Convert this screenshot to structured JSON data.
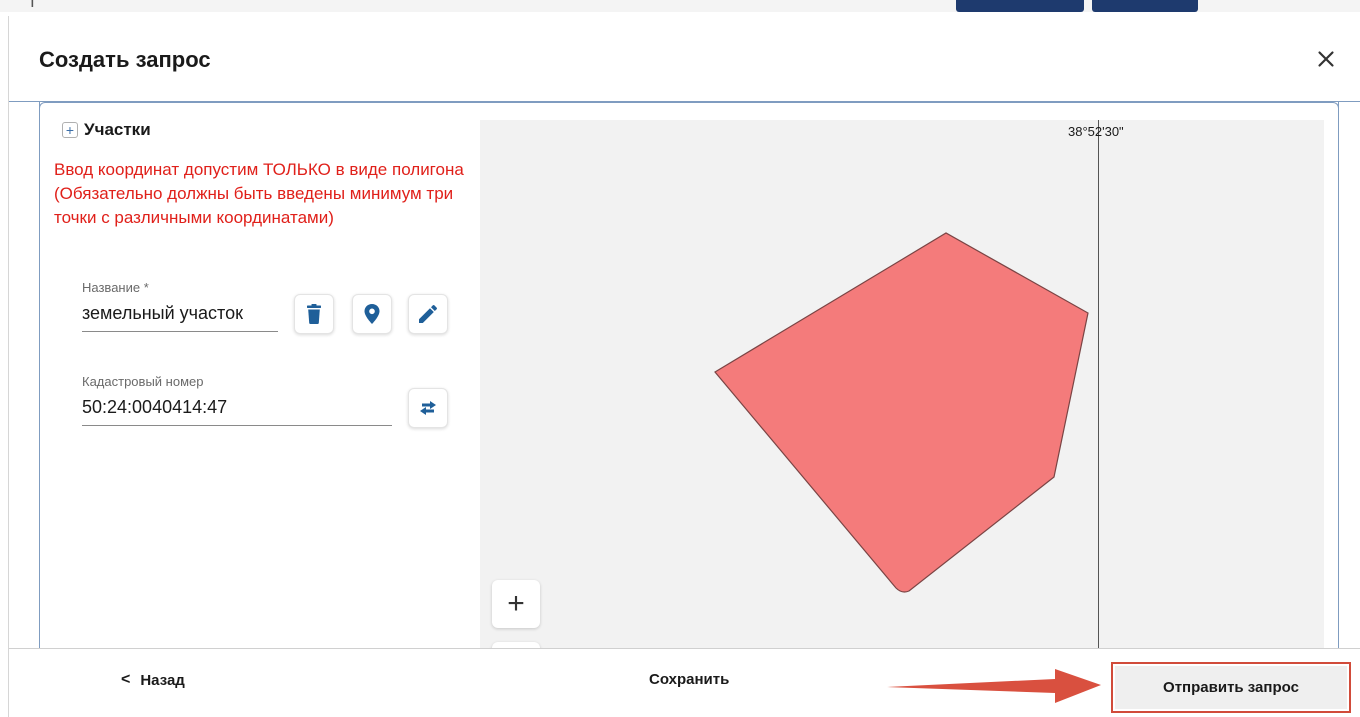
{
  "dialog": {
    "title": "Создать запрос",
    "close_icon": "close-icon"
  },
  "section": {
    "title": "Участки",
    "expand_icon": "plus-icon"
  },
  "warning": "Ввод координат допустим ТОЛЬКО в виде полигона (Обязательно должны быть введены минимум три точки с различными координатами)",
  "fields": {
    "name": {
      "label": "Название *",
      "value": "земельный участок"
    },
    "cadastral": {
      "label": "Кадастровый номер",
      "value": "50:24:0040414:47"
    }
  },
  "actions": {
    "delete_icon": "trash-icon",
    "locate_icon": "map-pin-icon",
    "edit_icon": "pencil-icon",
    "swap_icon": "swap-arrows-icon"
  },
  "map": {
    "coordinate_label": "38°52'30\"",
    "zoom_in_label": "+",
    "polygon_color": "#f47b7b",
    "polygon_stroke": "#7a4444",
    "background": "#f2f2f2"
  },
  "footer": {
    "back_label": "Назад",
    "save_label": "Сохранить",
    "send_label": "Отправить запрос"
  },
  "colors": {
    "accent": "#1f5f99",
    "warning": "#e0201a",
    "highlight_border": "#d14b3a",
    "arrow": "#d9503f"
  }
}
